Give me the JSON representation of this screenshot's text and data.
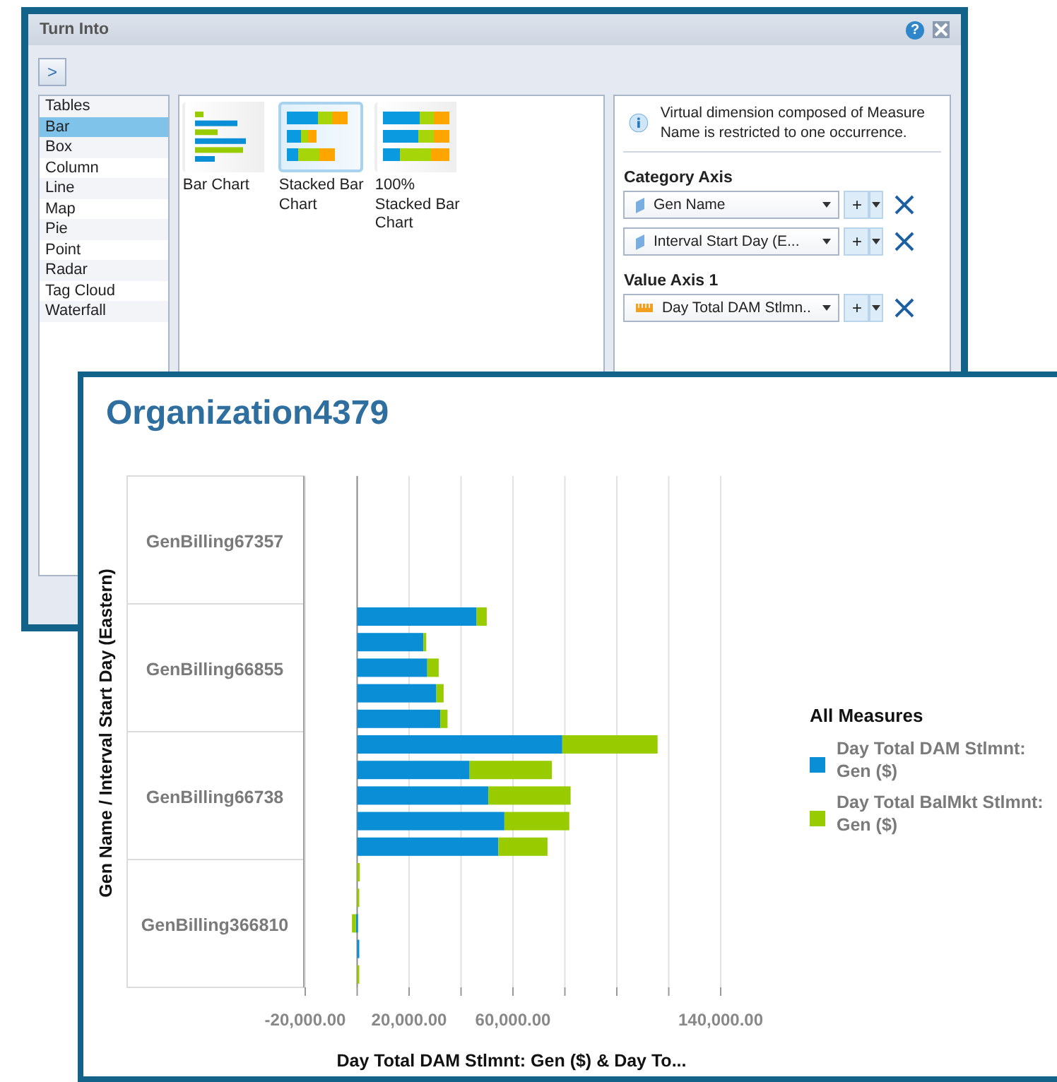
{
  "dialog": {
    "title": "Turn Into",
    "help_label": "?",
    "toggle_label": ">",
    "chart_types": [
      {
        "label": "Tables",
        "selected": false
      },
      {
        "label": "Bar",
        "selected": true
      },
      {
        "label": "Box",
        "selected": false
      },
      {
        "label": "Column",
        "selected": false
      },
      {
        "label": "Line",
        "selected": false
      },
      {
        "label": "Map",
        "selected": false
      },
      {
        "label": "Pie",
        "selected": false
      },
      {
        "label": "Point",
        "selected": false
      },
      {
        "label": "Radar",
        "selected": false
      },
      {
        "label": "Tag Cloud",
        "selected": false
      },
      {
        "label": "Waterfall",
        "selected": false
      }
    ],
    "variants": [
      {
        "kind": "bar",
        "label": "Bar Chart",
        "selected": false
      },
      {
        "kind": "stacked",
        "label": "Stacked Bar Chart",
        "selected": true
      },
      {
        "kind": "percent",
        "label": "100% Stacked Bar Chart",
        "selected": false
      }
    ],
    "info": "Virtual dimension composed of Measure Name is restricted to one occurrence.",
    "axes": [
      {
        "title": "Category Axis",
        "fields": [
          {
            "kind": "dimension",
            "value": "Gen Name"
          },
          {
            "kind": "dimension",
            "value": "Interval Start Day (E..."
          }
        ]
      },
      {
        "title": "Value Axis 1",
        "fields": [
          {
            "kind": "measure",
            "value": "Day Total DAM Stlmn.."
          }
        ]
      }
    ],
    "add_label": "+"
  },
  "report": {
    "title": "Organization4379",
    "legend_title": "All Measures",
    "x_axis_title": "Day Total DAM Stlmnt: Gen ($) & Day To...",
    "y_axis_title": "Gen Name / Interval Start Day (Eastern)",
    "category_labels": [
      "GenBilling67357",
      "GenBilling66855",
      "GenBilling66738",
      "GenBilling366810"
    ],
    "tick_labels": [
      "-20,000.00",
      "20,000.00",
      "60,000.00",
      "140,000.00"
    ],
    "legend": [
      {
        "label": "Day Total DAM Stlmnt: Gen ($)",
        "color": "#0a8fd6"
      },
      {
        "label": "Day Total BalMkt Stlmnt: Gen ($)",
        "color": "#99cc00"
      }
    ]
  }
}
